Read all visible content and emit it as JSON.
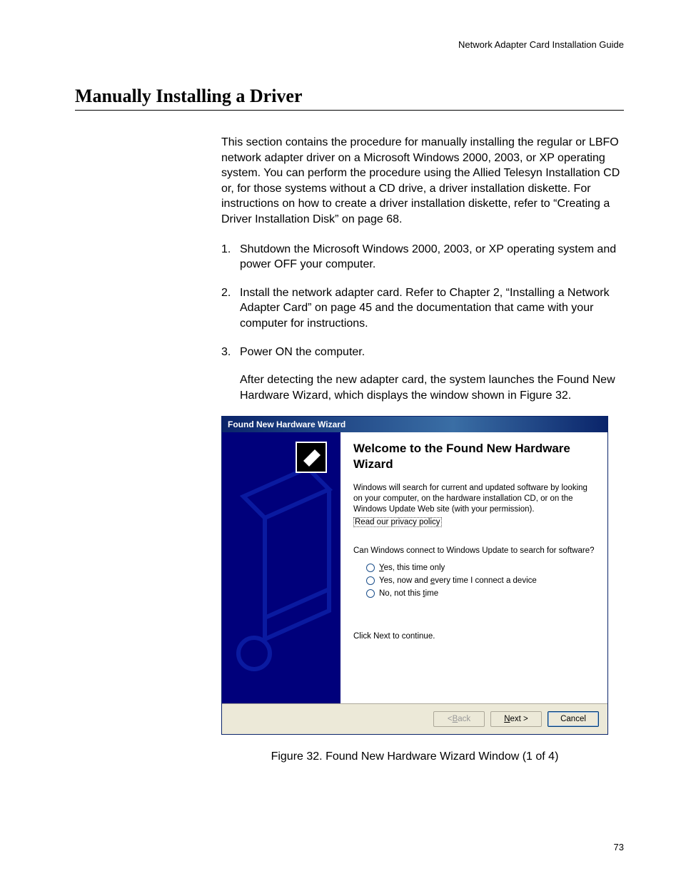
{
  "header": {
    "running_head": "Network Adapter Card Installation Guide"
  },
  "section": {
    "title": "Manually Installing a Driver",
    "intro": "This section contains the procedure for manually installing the regular or LBFO network adapter driver on a Microsoft Windows 2000, 2003, or XP operating system. You can perform the procedure using the Allied Telesyn Installation CD or, for those systems without a CD drive, a driver installation diskette. For instructions on how to create a driver installation diskette, refer to “Creating a Driver Installation Disk” on page 68.",
    "steps": [
      {
        "num": "1.",
        "text": "Shutdown the Microsoft Windows 2000, 2003, or XP operating system and power OFF your computer."
      },
      {
        "num": "2.",
        "text": "Install the network adapter card. Refer to Chapter 2, “Installing a Network Adapter Card” on page 45 and the documentation that came with your computer for instructions."
      },
      {
        "num": "3.",
        "text": "Power ON the computer.",
        "sub": "After detecting the new adapter card, the system launches the Found New Hardware Wizard, which displays the window shown in Figure 32."
      }
    ]
  },
  "wizard": {
    "titlebar": "Found New Hardware Wizard",
    "heading": "Welcome to the Found New Hardware Wizard",
    "para": "Windows will search for current and updated software by looking on your computer, on the hardware installation CD, or on the Windows Update Web site (with your permission).",
    "link": "Read our privacy policy",
    "question": "Can Windows connect to Windows Update to search for software?",
    "radios": {
      "opt1_pre": "",
      "opt1_u": "Y",
      "opt1_post": "es, this time only",
      "opt2_pre": "Yes, now and ",
      "opt2_u": "e",
      "opt2_post": "very time I connect a device",
      "opt3_pre": "No, not this ",
      "opt3_u": "t",
      "opt3_post": "ime"
    },
    "continue": "Click Next to continue.",
    "buttons": {
      "back_pre": "< ",
      "back_u": "B",
      "back_post": "ack",
      "next_u": "N",
      "next_post": "ext >",
      "cancel": "Cancel"
    }
  },
  "figure": {
    "caption": "Figure 32. Found New Hardware Wizard Window (1 of 4)"
  },
  "page_number": "73"
}
